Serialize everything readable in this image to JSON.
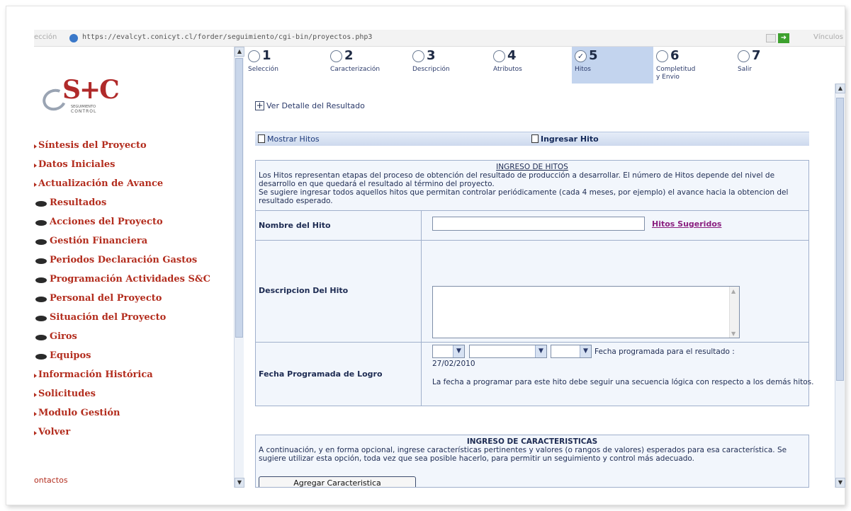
{
  "browser": {
    "address_prefix": "ección",
    "url": "https://evalcyt.conicyt.cl/forder/seguimiento/cgi-bin/proyectos.php3",
    "right_label": "Vínculos"
  },
  "logo": {
    "text": "S+C",
    "sub1": "SEGUIMIENTO",
    "sub2": "CONTROL"
  },
  "sidebar": {
    "items": [
      {
        "label": "Síntesis del Proyecto",
        "level": "top"
      },
      {
        "label": "Datos Iniciales",
        "level": "top"
      },
      {
        "label": "Actualización de Avance",
        "level": "top"
      },
      {
        "label": "Resultados",
        "level": "sub"
      },
      {
        "label": "Acciones del Proyecto",
        "level": "sub"
      },
      {
        "label": "Gestión Financiera",
        "level": "sub"
      },
      {
        "label": "Periodos Declaración Gastos",
        "level": "sub"
      },
      {
        "label": "Programación Actividades S&C",
        "level": "sub"
      },
      {
        "label": "Personal del Proyecto",
        "level": "sub"
      },
      {
        "label": "Situación del Proyecto",
        "level": "sub"
      },
      {
        "label": "Giros",
        "level": "sub"
      },
      {
        "label": "Equipos",
        "level": "sub"
      },
      {
        "label": "Información Histórica",
        "level": "top"
      },
      {
        "label": "Solicitudes",
        "level": "top"
      },
      {
        "label": "Modulo Gestión",
        "level": "top"
      },
      {
        "label": "Volver",
        "level": "top"
      }
    ],
    "contact": "ontactos"
  },
  "steps": [
    {
      "num": "1",
      "label": "Selección",
      "label2": ""
    },
    {
      "num": "2",
      "label": "Caracterización",
      "label2": ""
    },
    {
      "num": "3",
      "label": "Descripción",
      "label2": ""
    },
    {
      "num": "4",
      "label": "Atributos",
      "label2": ""
    },
    {
      "num": "5",
      "label": "Hitos",
      "label2": "",
      "active": true
    },
    {
      "num": "6",
      "label": "Completitud",
      "label2": "y Envio"
    },
    {
      "num": "7",
      "label": "Salir",
      "label2": ""
    }
  ],
  "content": {
    "detail_link": "Ver  Detalle  del  Resultado",
    "tab_show": "Mostrar Hitos",
    "tab_add": "Ingresar Hito",
    "section_title": "INGRESO DE HITOS",
    "intro1": "Los Hitos representan etapas del proceso de obtención del resultado de producción a desarrollar. El número de Hitos depende del nivel de desarrollo en que quedará el resultado al término del proyecto.",
    "intro2": "Se sugiere ingresar todos aquellos hitos que permitan controlar periódicamente (cada 4 meses, por ejemplo) el avance hacia la obtencion del resultado esperado.",
    "name_label": "Nombre del Hito",
    "name_value": "",
    "suggest_link": "Hitos Sugeridos",
    "desc_label": "Descripcion Del Hito",
    "desc_value": "",
    "date_label": "Fecha Programada de Logro",
    "date_text": "Fecha programada para el resultado :",
    "date_value": "27/02/2010",
    "date_note": "La fecha a programar para este hito debe seguir una secuencia lógica con respecto a los demás hitos.",
    "char_title": "INGRESO DE CARACTERISTICAS",
    "char_text": "A continuación, y en forma opcional, ingrese características pertinentes y valores (o rangos de valores) esperados para esa característica. Se sugiere utilizar esta opción, toda vez que sea posible hacerlo, para permitir un seguimiento y control más adecuado.",
    "add_button": "Agregar Caracteristica"
  },
  "colors": {
    "menu_text": "#b32d1e",
    "active_step": "#c3d4ee",
    "link_purple": "#8a2080"
  }
}
